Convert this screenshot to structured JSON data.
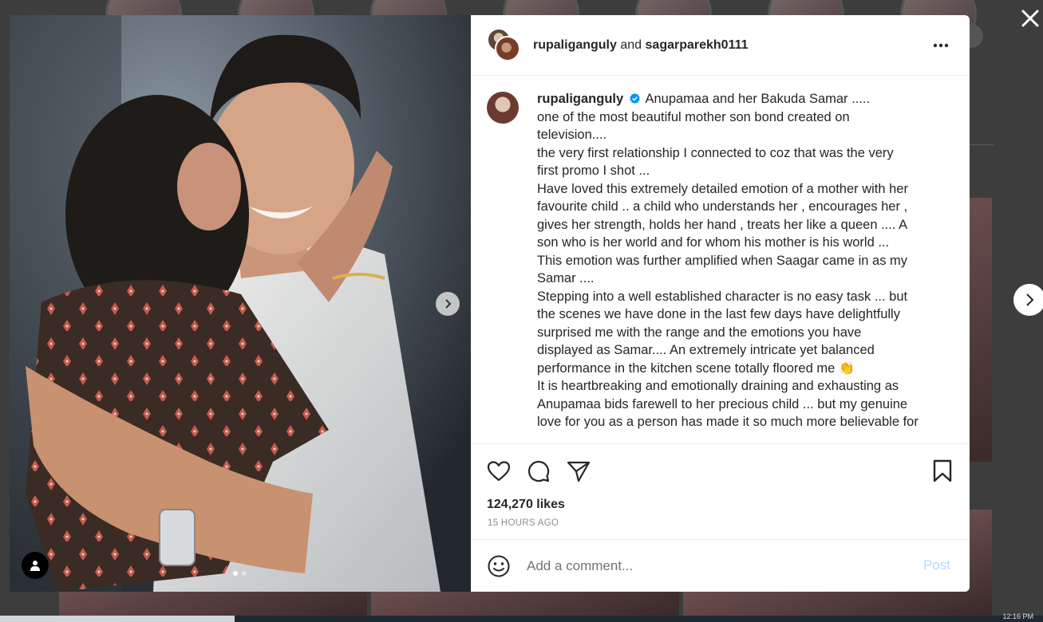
{
  "header": {
    "user1": "rupaliganguly",
    "joiner": "and",
    "user2": "sagarparekh0111"
  },
  "caption": {
    "username": "rupaliganguly",
    "lines": [
      "Anupamaa and her Bakuda Samar .....",
      "one of the most beautiful mother son bond created on",
      "television....",
      "the very first relationship I connected to coz that was the very",
      "first promo I shot ...",
      "Have loved this extremely detailed emotion of a mother with her",
      "favourite child .. a child who understands her , encourages her ,",
      "gives her strength, holds her hand , treats her like a queen .... A",
      "son who is her world and for whom his mother is his world ...",
      "This emotion was further amplified when Saagar came in as my",
      "Samar ....",
      "Stepping into a well established character is no easy task ... but",
      "the scenes we have done in the last few days have delightfully",
      "surprised me with the range and the emotions you have",
      "displayed as Samar.... An extremely intricate yet balanced",
      "performance in the kitchen scene totally floored me",
      "It is heartbreaking and emotionally draining and exhausting as",
      "Anupamaa bids farewell to her precious child ... but my genuine",
      "love for you as a person has made it so much more believable for"
    ],
    "emoji": "👏"
  },
  "likes": "124,270 likes",
  "time": "15 HOURS AGO",
  "comment": {
    "placeholder": "Add a comment...",
    "post_label": "Post"
  },
  "taskbar": {
    "clock": "12:16 PM"
  },
  "icons": {
    "close": "close-icon",
    "next_post": "chevron-right-icon",
    "carousel_next": "chevron-right-icon",
    "tag": "user-tag-icon",
    "more": "more-horizontal-icon",
    "verified": "verified-badge-icon",
    "like": "heart-icon",
    "comment": "comment-icon",
    "share": "paper-plane-icon",
    "save": "bookmark-icon",
    "emoji": "smiley-icon"
  },
  "colors": {
    "verified": "#0095f6",
    "post_disabled": "#b3dbff",
    "text": "#262626",
    "muted": "#8e8e8e"
  },
  "carousel": {
    "slides": 2,
    "active_slide": 1
  }
}
